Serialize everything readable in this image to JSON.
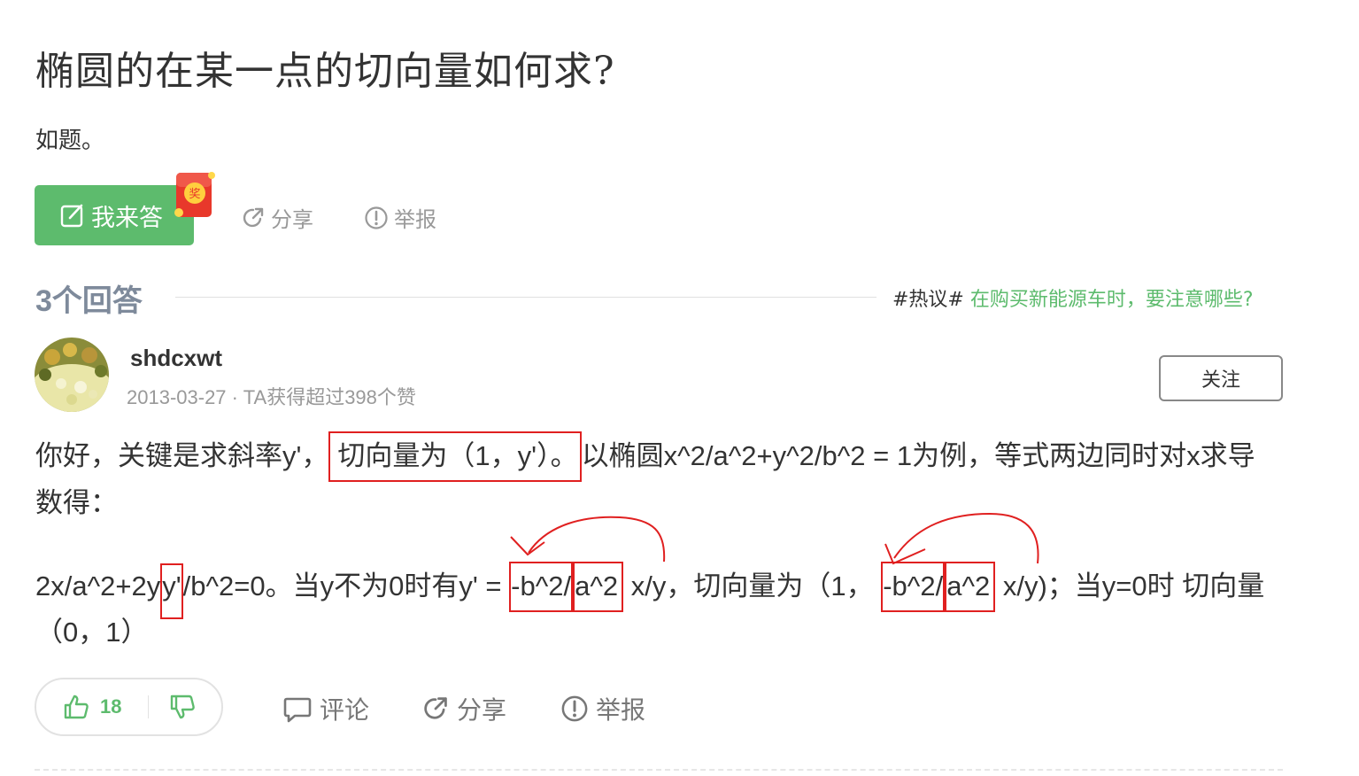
{
  "question": {
    "title": "椭圆的在某一点的切向量如何求?",
    "description": "如题。",
    "answer_button": "我来答",
    "redpacket_char": "奖",
    "share": "分享",
    "report": "举报"
  },
  "answers_header": {
    "count_label": "3个回答",
    "hot_tag": "#热议#",
    "hot_link": "在购买新能源车时，要注意哪些?"
  },
  "answer": {
    "username": "shdcxwt",
    "date": "2013-03-27",
    "meta_sep": "·",
    "likes_text": "TA获得超过398个赞",
    "follow": "关注",
    "line1": {
      "pre": "你好，关键是求斜率y'，",
      "boxed": "切向量为（1，y'）。",
      "post": "以椭圆x^2/a^2+y^2/b^2 = 1为例，等式两边同时对x求导"
    },
    "line2": "数得：",
    "line3": {
      "a": "2x/a^2+2y",
      "b": "y'",
      "c": "/b^2=0。当y不为0时有y' = ",
      "d": "-b^2/",
      "e": "a^2",
      "f": " x/y，切向量为（1，  ",
      "g": "-b^2/",
      "h": "a^2",
      "i": " x/y)；当y=0时 切向量"
    },
    "line4": "（0，1）",
    "like_count": "18",
    "comment": "评论",
    "share": "分享",
    "report": "举报"
  },
  "colors": {
    "brand_green": "#5dbb6d",
    "annotation_red": "#e02020",
    "muted_text": "#999999"
  }
}
